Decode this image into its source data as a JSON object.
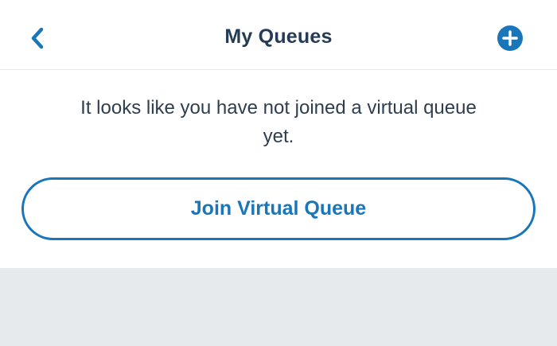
{
  "header": {
    "title": "My Queues",
    "back_icon": "chevron-left-icon",
    "add_icon": "plus-circle-icon"
  },
  "main": {
    "message": "It looks like you have not joined a virtual queue yet.",
    "join_button_label": "Join Virtual Queue"
  },
  "colors": {
    "accent": "#1a76b8",
    "title_text": "#253b56",
    "body_text": "#2f3e4f",
    "background_gray": "#e6eaed"
  }
}
